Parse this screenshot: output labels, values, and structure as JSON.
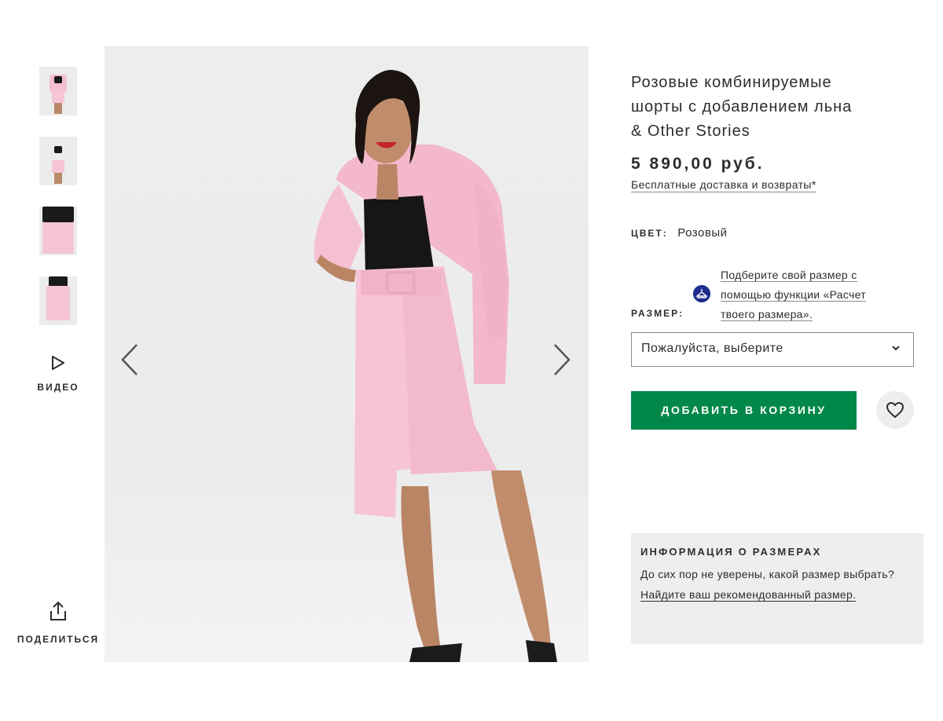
{
  "product": {
    "title_line1": "Розовые комбинируемые",
    "title_line2": "шорты с добавлением льна",
    "title_line3": "& Other Stories",
    "price": "5 890,00 руб.",
    "delivery_link": "Бесплатные доставка и возвраты*"
  },
  "gallery": {
    "thumbnails": [
      "thumb-1",
      "thumb-2",
      "thumb-3",
      "thumb-4"
    ],
    "video_label": "ВИДЕО",
    "share_label": "ПОДЕЛИТЬСЯ"
  },
  "color": {
    "label": "ЦВЕТ:",
    "value": "Розовый"
  },
  "size": {
    "label": "РАЗМЕР:",
    "fit_line1": "Подберите свой размер с",
    "fit_line2": "помощью функции «Расчет",
    "fit_line3": "твоего размера».",
    "select_value": "Пожалуйста, выберите"
  },
  "actions": {
    "add_to_cart": "ДОБАВИТЬ В КОРЗИНУ"
  },
  "size_info": {
    "heading": "ИНФОРМАЦИЯ О РАЗМЕРАХ",
    "text": "До сих пор не уверены, какой размер выбрать? ",
    "link": "Найдите ваш рекомендованный размер."
  },
  "colors": {
    "accent_green": "#018849",
    "fit_icon_blue": "#1f2d8f",
    "panel_grey": "#eeeeee"
  },
  "icons": [
    "play-icon",
    "share-icon",
    "chevron-left-icon",
    "chevron-right-icon",
    "chevron-down-icon",
    "heart-icon",
    "fit-assistant-icon"
  ]
}
